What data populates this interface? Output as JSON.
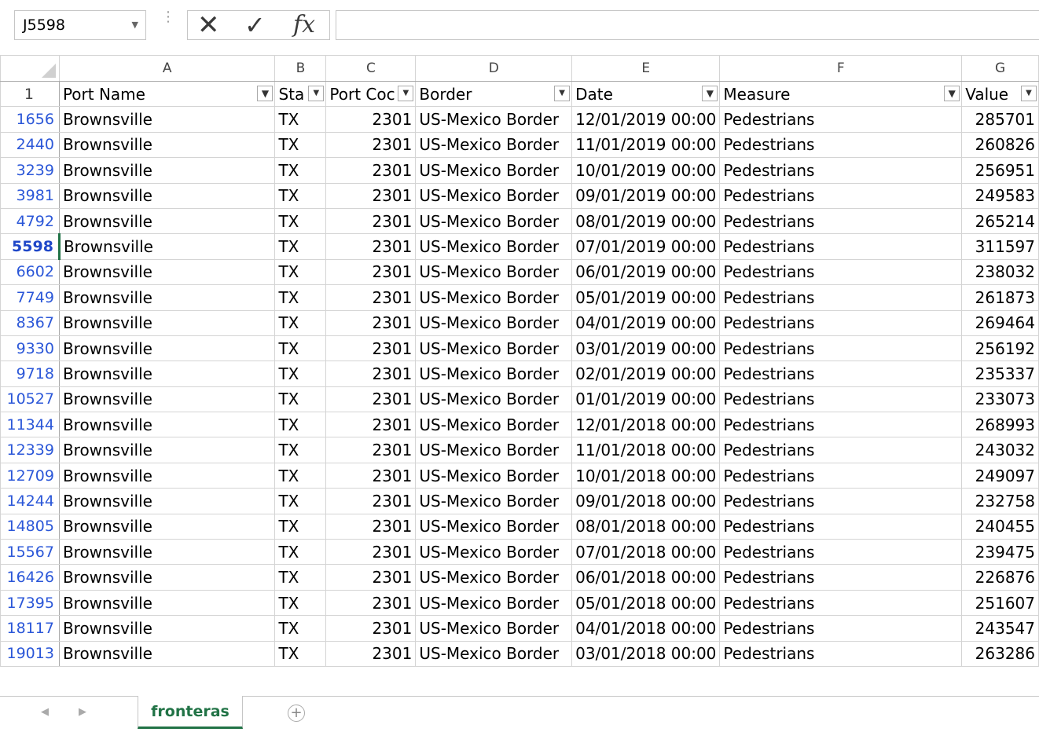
{
  "formula_bar": {
    "name_box": "J5598",
    "formula": ""
  },
  "columns": [
    "A",
    "B",
    "C",
    "D",
    "E",
    "F",
    "G"
  ],
  "header_row_number": "1",
  "headers": [
    "Port Name",
    "Sta",
    "Port Coc",
    "Border",
    "Date",
    "Measure",
    "Value"
  ],
  "rows": [
    {
      "n": "1656",
      "a": "Brownsville",
      "b": "TX",
      "c": "2301",
      "d": "US-Mexico Border",
      "e": "12/01/2019 00:00",
      "f": "Pedestrians",
      "g": "285701"
    },
    {
      "n": "2440",
      "a": "Brownsville",
      "b": "TX",
      "c": "2301",
      "d": "US-Mexico Border",
      "e": "11/01/2019 00:00",
      "f": "Pedestrians",
      "g": "260826"
    },
    {
      "n": "3239",
      "a": "Brownsville",
      "b": "TX",
      "c": "2301",
      "d": "US-Mexico Border",
      "e": "10/01/2019 00:00",
      "f": "Pedestrians",
      "g": "256951"
    },
    {
      "n": "3981",
      "a": "Brownsville",
      "b": "TX",
      "c": "2301",
      "d": "US-Mexico Border",
      "e": "09/01/2019 00:00",
      "f": "Pedestrians",
      "g": "249583"
    },
    {
      "n": "4792",
      "a": "Brownsville",
      "b": "TX",
      "c": "2301",
      "d": "US-Mexico Border",
      "e": "08/01/2019 00:00",
      "f": "Pedestrians",
      "g": "265214"
    },
    {
      "n": "5598",
      "a": "Brownsville",
      "b": "TX",
      "c": "2301",
      "d": "US-Mexico Border",
      "e": "07/01/2019 00:00",
      "f": "Pedestrians",
      "g": "311597",
      "active": true
    },
    {
      "n": "6602",
      "a": "Brownsville",
      "b": "TX",
      "c": "2301",
      "d": "US-Mexico Border",
      "e": "06/01/2019 00:00",
      "f": "Pedestrians",
      "g": "238032"
    },
    {
      "n": "7749",
      "a": "Brownsville",
      "b": "TX",
      "c": "2301",
      "d": "US-Mexico Border",
      "e": "05/01/2019 00:00",
      "f": "Pedestrians",
      "g": "261873"
    },
    {
      "n": "8367",
      "a": "Brownsville",
      "b": "TX",
      "c": "2301",
      "d": "US-Mexico Border",
      "e": "04/01/2019 00:00",
      "f": "Pedestrians",
      "g": "269464"
    },
    {
      "n": "9330",
      "a": "Brownsville",
      "b": "TX",
      "c": "2301",
      "d": "US-Mexico Border",
      "e": "03/01/2019 00:00",
      "f": "Pedestrians",
      "g": "256192"
    },
    {
      "n": "9718",
      "a": "Brownsville",
      "b": "TX",
      "c": "2301",
      "d": "US-Mexico Border",
      "e": "02/01/2019 00:00",
      "f": "Pedestrians",
      "g": "235337"
    },
    {
      "n": "10527",
      "a": "Brownsville",
      "b": "TX",
      "c": "2301",
      "d": "US-Mexico Border",
      "e": "01/01/2019 00:00",
      "f": "Pedestrians",
      "g": "233073"
    },
    {
      "n": "11344",
      "a": "Brownsville",
      "b": "TX",
      "c": "2301",
      "d": "US-Mexico Border",
      "e": "12/01/2018 00:00",
      "f": "Pedestrians",
      "g": "268993"
    },
    {
      "n": "12339",
      "a": "Brownsville",
      "b": "TX",
      "c": "2301",
      "d": "US-Mexico Border",
      "e": "11/01/2018 00:00",
      "f": "Pedestrians",
      "g": "243032"
    },
    {
      "n": "12709",
      "a": "Brownsville",
      "b": "TX",
      "c": "2301",
      "d": "US-Mexico Border",
      "e": "10/01/2018 00:00",
      "f": "Pedestrians",
      "g": "249097"
    },
    {
      "n": "14244",
      "a": "Brownsville",
      "b": "TX",
      "c": "2301",
      "d": "US-Mexico Border",
      "e": "09/01/2018 00:00",
      "f": "Pedestrians",
      "g": "232758"
    },
    {
      "n": "14805",
      "a": "Brownsville",
      "b": "TX",
      "c": "2301",
      "d": "US-Mexico Border",
      "e": "08/01/2018 00:00",
      "f": "Pedestrians",
      "g": "240455"
    },
    {
      "n": "15567",
      "a": "Brownsville",
      "b": "TX",
      "c": "2301",
      "d": "US-Mexico Border",
      "e": "07/01/2018 00:00",
      "f": "Pedestrians",
      "g": "239475"
    },
    {
      "n": "16426",
      "a": "Brownsville",
      "b": "TX",
      "c": "2301",
      "d": "US-Mexico Border",
      "e": "06/01/2018 00:00",
      "f": "Pedestrians",
      "g": "226876"
    },
    {
      "n": "17395",
      "a": "Brownsville",
      "b": "TX",
      "c": "2301",
      "d": "US-Mexico Border",
      "e": "05/01/2018 00:00",
      "f": "Pedestrians",
      "g": "251607"
    },
    {
      "n": "18117",
      "a": "Brownsville",
      "b": "TX",
      "c": "2301",
      "d": "US-Mexico Border",
      "e": "04/01/2018 00:00",
      "f": "Pedestrians",
      "g": "243547"
    },
    {
      "n": "19013",
      "a": "Brownsville",
      "b": "TX",
      "c": "2301",
      "d": "US-Mexico Border",
      "e": "03/01/2018 00:00",
      "f": "Pedestrians",
      "g": "263286"
    }
  ],
  "sheet_tabs": [
    {
      "label": "fronteras",
      "active": true
    }
  ],
  "colors": {
    "accent": "#217346",
    "row_number": "#2b57d8"
  }
}
